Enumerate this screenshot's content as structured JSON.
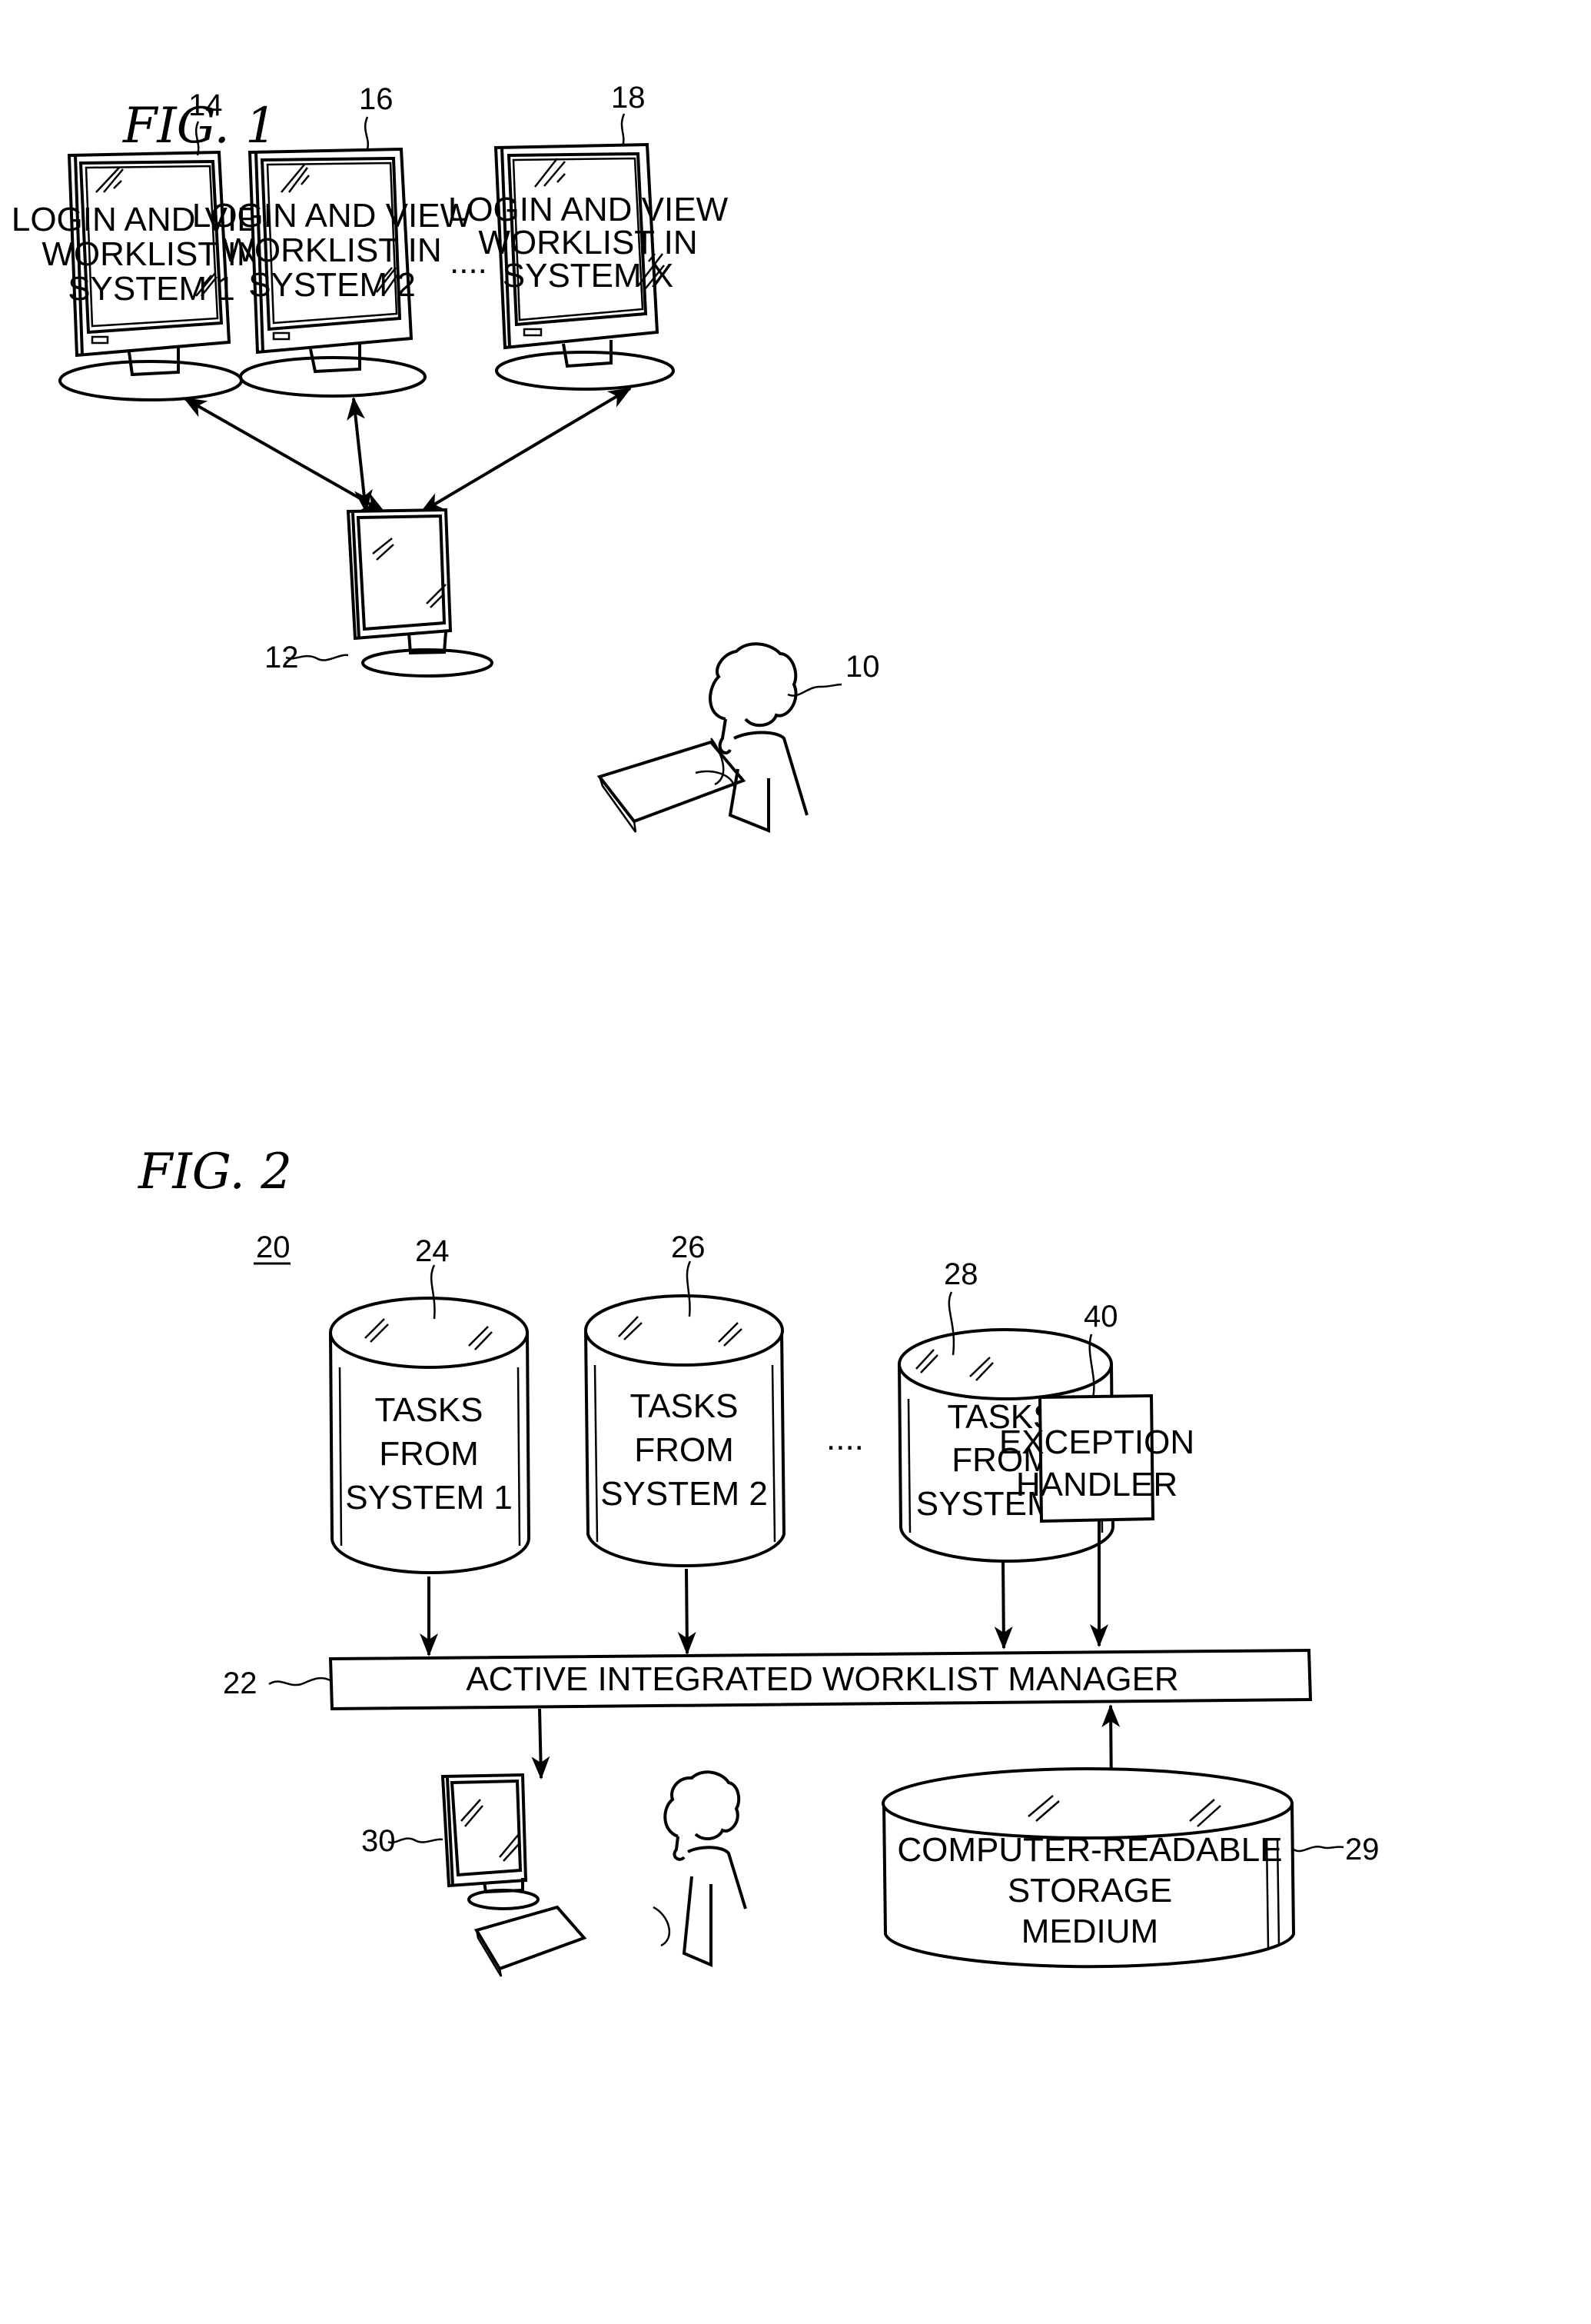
{
  "fig1": {
    "title": "FIG. 1",
    "monitors": [
      {
        "ref": "14",
        "lines": [
          "LOGIN AND VIEW",
          "WORKLIST IN",
          "SYSTEM 1"
        ]
      },
      {
        "ref": "16",
        "lines": [
          "LOGIN AND VIEW",
          "WORKLIST IN",
          "SYSTEM 2"
        ]
      },
      {
        "ref": "18",
        "lines": [
          "LOGIN AND VIEW",
          "WORKLIST IN",
          "SYSTEM X"
        ]
      }
    ],
    "ellipsis": "....",
    "user_workstation_ref": "12",
    "user_ref": "10"
  },
  "fig2": {
    "title": "FIG. 2",
    "system_ref": "20",
    "task_stores": [
      {
        "ref": "24",
        "lines": [
          "TASKS",
          "FROM",
          "SYSTEM 1"
        ]
      },
      {
        "ref": "26",
        "lines": [
          "TASKS",
          "FROM",
          "SYSTEM 2"
        ]
      },
      {
        "ref": "28",
        "lines": [
          "TASKS",
          "FROM",
          "SYSTEM X"
        ]
      }
    ],
    "ellipsis": "....",
    "exception_handler": {
      "ref": "40",
      "lines": [
        "EXCEPTION",
        "HANDLER"
      ]
    },
    "manager": {
      "ref": "22",
      "label": "ACTIVE INTEGRATED WORKLIST MANAGER"
    },
    "workstation_ref": "30",
    "storage": {
      "ref": "29",
      "lines": [
        "COMPUTER-READABLE",
        "STORAGE",
        "MEDIUM"
      ]
    }
  }
}
